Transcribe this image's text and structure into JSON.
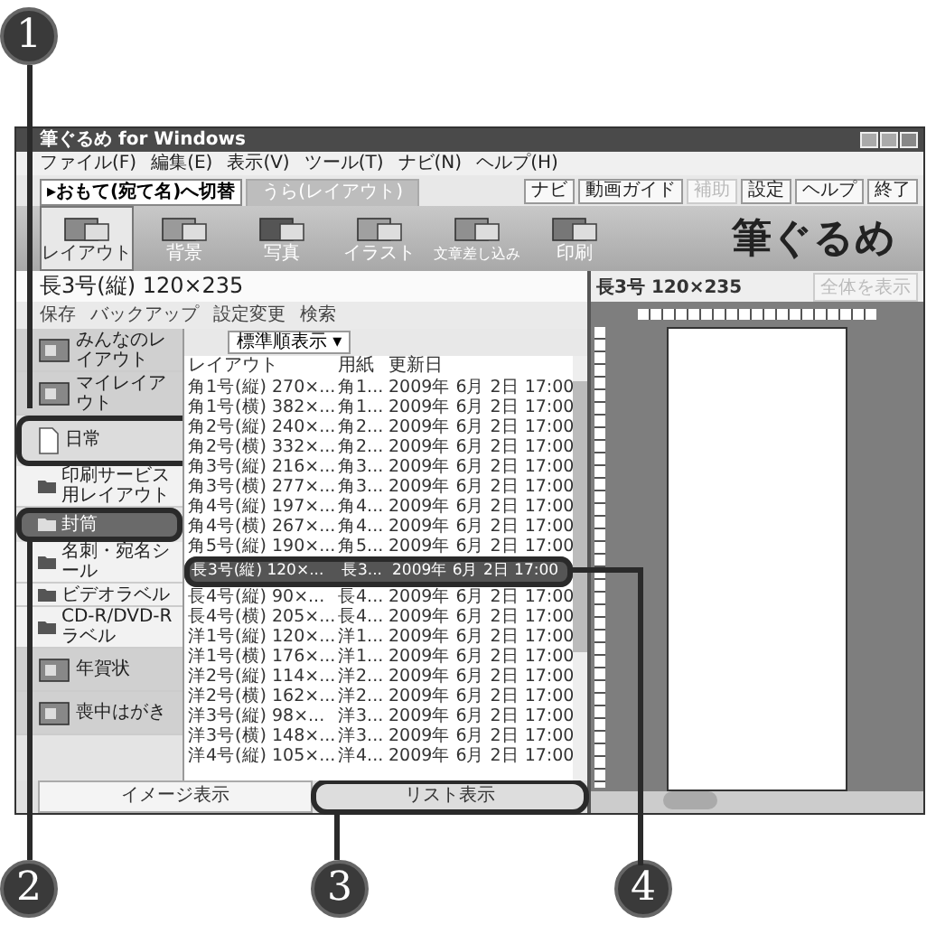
{
  "window": {
    "title": "筆ぐるめ for Windows"
  },
  "menu": [
    "ファイル(F)",
    "編集(E)",
    "表示(V)",
    "ツール(T)",
    "ナビ(N)",
    "ヘルプ(H)"
  ],
  "switch_button": "▸おもて(宛て名)へ切替",
  "tabs": [
    {
      "label": "うら(レイアウト)",
      "selected": true
    }
  ],
  "top_buttons": [
    {
      "label": "ナビ",
      "disabled": false
    },
    {
      "label": "動画ガイド",
      "disabled": false
    },
    {
      "label": "補助",
      "disabled": true
    },
    {
      "label": "設定",
      "disabled": false
    },
    {
      "label": "ヘルプ",
      "disabled": false
    },
    {
      "label": "終了",
      "disabled": false
    }
  ],
  "toolbar": [
    {
      "label": "レイアウト",
      "selected": true
    },
    {
      "label": "背景",
      "selected": false
    },
    {
      "label": "写真",
      "selected": false
    },
    {
      "label": "イラスト",
      "selected": false
    },
    {
      "label": "文章差し込み",
      "selected": false
    },
    {
      "label": "印刷",
      "selected": false
    }
  ],
  "logo": "筆ぐるめ",
  "layout_panel": {
    "title": "長3号(縦) 120×235",
    "actions": [
      "保存",
      "バックアップ",
      "設定変更",
      "検索"
    ],
    "sort": "標準順表示",
    "sort_arrow": "▾",
    "columns": [
      "レイアウト",
      "用紙",
      "更新日"
    ],
    "rows": [
      {
        "layout": "角1号(縦) 270×...",
        "paper": "角1...",
        "date": "2009年 6月 2日 17:00",
        "selected": false
      },
      {
        "layout": "角1号(横) 382×...",
        "paper": "角1...",
        "date": "2009年 6月 2日 17:00",
        "selected": false
      },
      {
        "layout": "角2号(縦) 240×...",
        "paper": "角2...",
        "date": "2009年 6月 2日 17:00",
        "selected": false
      },
      {
        "layout": "角2号(横) 332×...",
        "paper": "角2...",
        "date": "2009年 6月 2日 17:00",
        "selected": false
      },
      {
        "layout": "角3号(縦) 216×...",
        "paper": "角3...",
        "date": "2009年 6月 2日 17:00",
        "selected": false
      },
      {
        "layout": "角3号(横) 277×...",
        "paper": "角3...",
        "date": "2009年 6月 2日 17:00",
        "selected": false
      },
      {
        "layout": "角4号(縦) 197×...",
        "paper": "角4...",
        "date": "2009年 6月 2日 17:00",
        "selected": false
      },
      {
        "layout": "角4号(横) 267×...",
        "paper": "角4...",
        "date": "2009年 6月 2日 17:00",
        "selected": false
      },
      {
        "layout": "角5号(縦) 190×...",
        "paper": "角5...",
        "date": "2009年 6月 2日 17:00",
        "selected": false
      },
      {
        "layout": "長3号(縦) 120×...",
        "paper": "長3...",
        "date": "2009年 6月 2日 17:00",
        "selected": true,
        "callout": "4"
      },
      {
        "layout": "長4号(縦) 90×...",
        "paper": "長4...",
        "date": "2009年 6月 2日 17:00",
        "selected": false
      },
      {
        "layout": "長4号(横) 205×...",
        "paper": "長4...",
        "date": "2009年 6月 2日 17:00",
        "selected": false
      },
      {
        "layout": "洋1号(縦) 120×...",
        "paper": "洋1...",
        "date": "2009年 6月 2日 17:00",
        "selected": false
      },
      {
        "layout": "洋1号(横) 176×...",
        "paper": "洋1...",
        "date": "2009年 6月 2日 17:00",
        "selected": false
      },
      {
        "layout": "洋2号(縦) 114×...",
        "paper": "洋2...",
        "date": "2009年 6月 2日 17:00",
        "selected": false
      },
      {
        "layout": "洋2号(横) 162×...",
        "paper": "洋2...",
        "date": "2009年 6月 2日 17:00",
        "selected": false
      },
      {
        "layout": "洋3号(縦) 98×...",
        "paper": "洋3...",
        "date": "2009年 6月 2日 17:00",
        "selected": false
      },
      {
        "layout": "洋3号(横) 148×...",
        "paper": "洋3...",
        "date": "2009年 6月 2日 17:00",
        "selected": false
      },
      {
        "layout": "洋4号(縦) 105×...",
        "paper": "洋4...",
        "date": "2009年 6月 2日 17:00",
        "selected": false
      }
    ]
  },
  "categories": [
    {
      "label": "みんなのレイアウト",
      "kind": "large",
      "selected": false
    },
    {
      "label": "マイレイアウト",
      "kind": "large",
      "selected": false
    },
    {
      "label": "日常",
      "kind": "page",
      "selected": false,
      "callout": "1"
    },
    {
      "label": "印刷サービス用レイアウト",
      "kind": "folder",
      "selected": false
    },
    {
      "label": "封筒",
      "kind": "folder",
      "selected": true,
      "callout": "2"
    },
    {
      "label": "名刺・宛名シール",
      "kind": "folder",
      "selected": false
    },
    {
      "label": "ビデオラベル",
      "kind": "folder",
      "selected": false
    },
    {
      "label": "CD-R/DVD-Rラベル",
      "kind": "folder",
      "selected": false
    },
    {
      "label": "年賀状",
      "kind": "large",
      "selected": false
    },
    {
      "label": "喪中はがき",
      "kind": "large",
      "selected": false
    }
  ],
  "view_buttons": [
    {
      "label": "イメージ表示",
      "selected": false
    },
    {
      "label": "リスト表示",
      "selected": true,
      "callout": "3"
    }
  ],
  "preview": {
    "title": "長3号 120×235",
    "zoom": "全体を表示"
  }
}
